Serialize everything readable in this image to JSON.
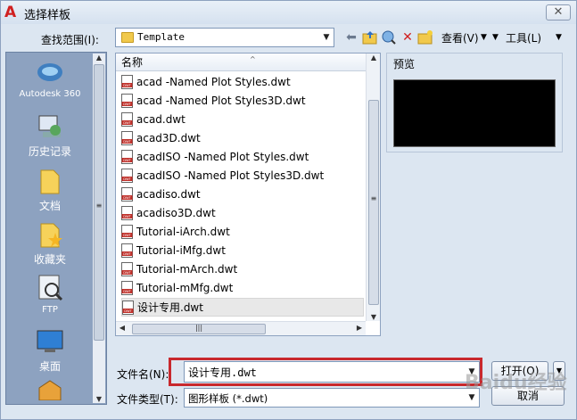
{
  "window": {
    "title": "选择样板",
    "close_label": "✕"
  },
  "toolbar": {
    "lookin_label": "查找范围(I):",
    "lookin_value": "Template",
    "views_label": "查看(V)",
    "tools_label": "工具(L)"
  },
  "places": [
    {
      "label": "Autodesk 360"
    },
    {
      "label": "历史记录"
    },
    {
      "label": "文档"
    },
    {
      "label": "收藏夹"
    },
    {
      "label": "FTP"
    },
    {
      "label": "桌面"
    }
  ],
  "filelist": {
    "column_header": "名称",
    "files": [
      "acad -Named Plot Styles.dwt",
      "acad -Named Plot Styles3D.dwt",
      "acad.dwt",
      "acad3D.dwt",
      "acadISO -Named Plot Styles.dwt",
      "acadISO -Named Plot Styles3D.dwt",
      "acadiso.dwt",
      "acadiso3D.dwt",
      "Tutorial-iArch.dwt",
      "Tutorial-iMfg.dwt",
      "Tutorial-mArch.dwt",
      "Tutorial-mMfg.dwt",
      "设计专用.dwt"
    ],
    "selected_index": 12,
    "icon_text": "DWT"
  },
  "preview": {
    "label": "预览"
  },
  "footer": {
    "filename_label": "文件名(N):",
    "filename_value": "设计专用.dwt",
    "filetype_label": "文件类型(T):",
    "filetype_value": "图形样板 (*.dwt)",
    "open_label": "打开(O)",
    "cancel_label": "取消"
  },
  "watermark": "Baidu经验"
}
